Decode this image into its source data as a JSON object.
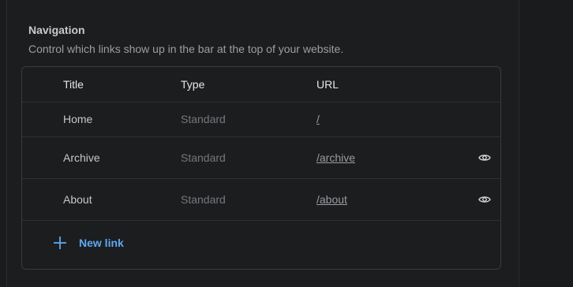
{
  "navigation": {
    "title": "Navigation",
    "description": "Control which links show up in the bar at the top of your website.",
    "columns": {
      "title": "Title",
      "type": "Type",
      "url": "URL"
    },
    "rows": [
      {
        "title": "Home",
        "type": "Standard",
        "url": "/",
        "visibility_icon": null
      },
      {
        "title": "Archive",
        "type": "Standard",
        "url": "/archive",
        "visibility_icon": "eye-icon"
      },
      {
        "title": "About",
        "type": "Standard",
        "url": "/about",
        "visibility_icon": "eye-icon"
      }
    ],
    "new_link_label": "New link",
    "new_link_icon": "plus-icon"
  },
  "colors": {
    "background": "#1c1d1f",
    "accent": "#5ea8f2",
    "border": "#3a3b3f"
  }
}
